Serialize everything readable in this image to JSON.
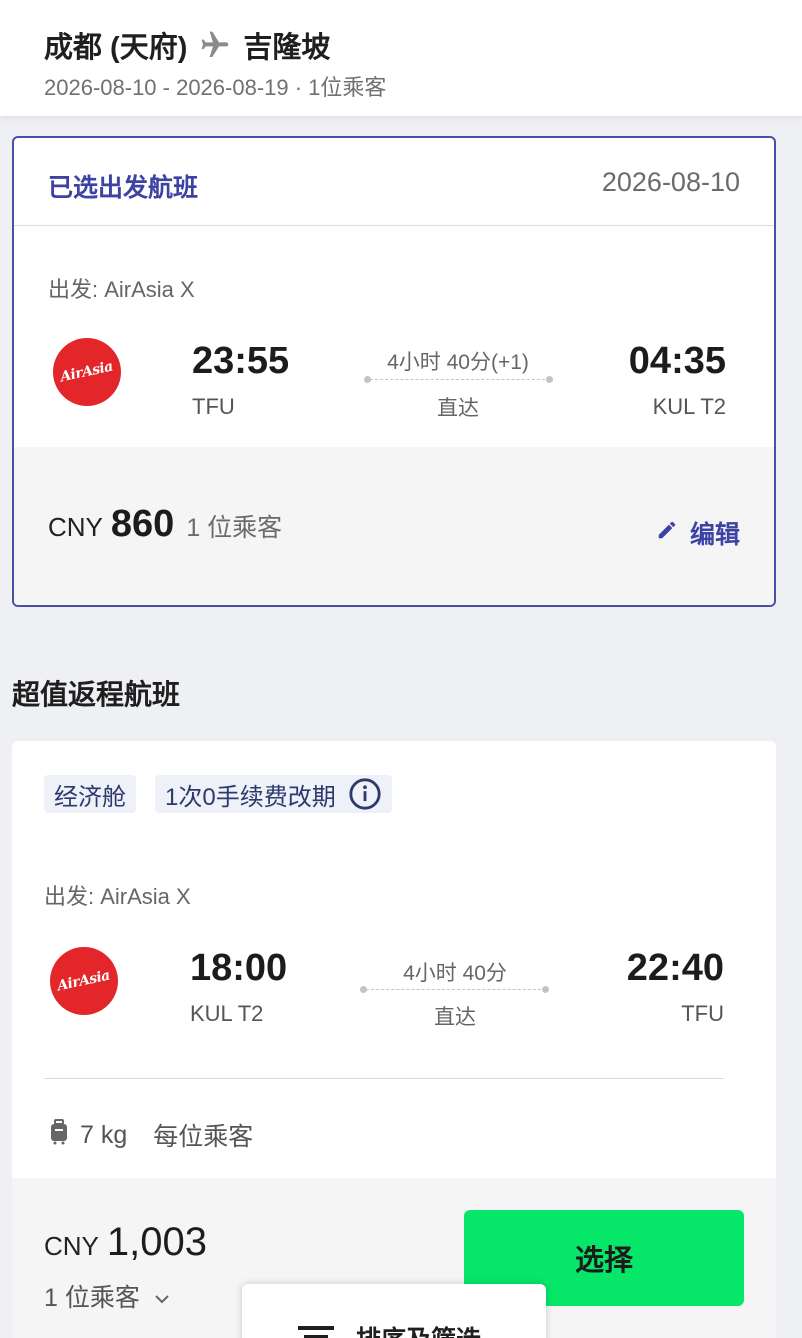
{
  "header": {
    "origin": "成都 (天府)",
    "destination": "吉隆坡",
    "trip_info": "2026-08-10 - 2026-08-19 · 1位乘客"
  },
  "selected_flight": {
    "title": "已选出发航班",
    "date": "2026-08-10",
    "airline_label": "出发: AirAsia X",
    "logo_text": "AirAsia",
    "depart_time": "23:55",
    "depart_code": "TFU",
    "duration": "4小时 40分(+1)",
    "stops": "直达",
    "arrive_time": "04:35",
    "arrive_code": "KUL T2",
    "currency": "CNY",
    "price": "860",
    "passengers": "1 位乘客",
    "edit_label": "编辑"
  },
  "section_title": "超值返程航班",
  "return_flight": {
    "tags": [
      "经济舱",
      "1次0手续费改期"
    ],
    "airline_label": "出发: AirAsia X",
    "logo_text": "AirAsia",
    "depart_time": "18:00",
    "depart_code": "KUL T2",
    "duration": "4小时 40分",
    "stops": "直达",
    "arrive_time": "22:40",
    "arrive_code": "TFU",
    "baggage_weight": "7 kg",
    "baggage_note": "每位乘客",
    "currency": "CNY",
    "price": "1,003",
    "passengers": "1 位乘客",
    "select_label": "选择"
  },
  "sort_filter_label": "排序及筛选",
  "colors": {
    "brand_blue": "#3d43a2",
    "select_green": "#06e76a",
    "airasia_red": "#e3262a"
  }
}
